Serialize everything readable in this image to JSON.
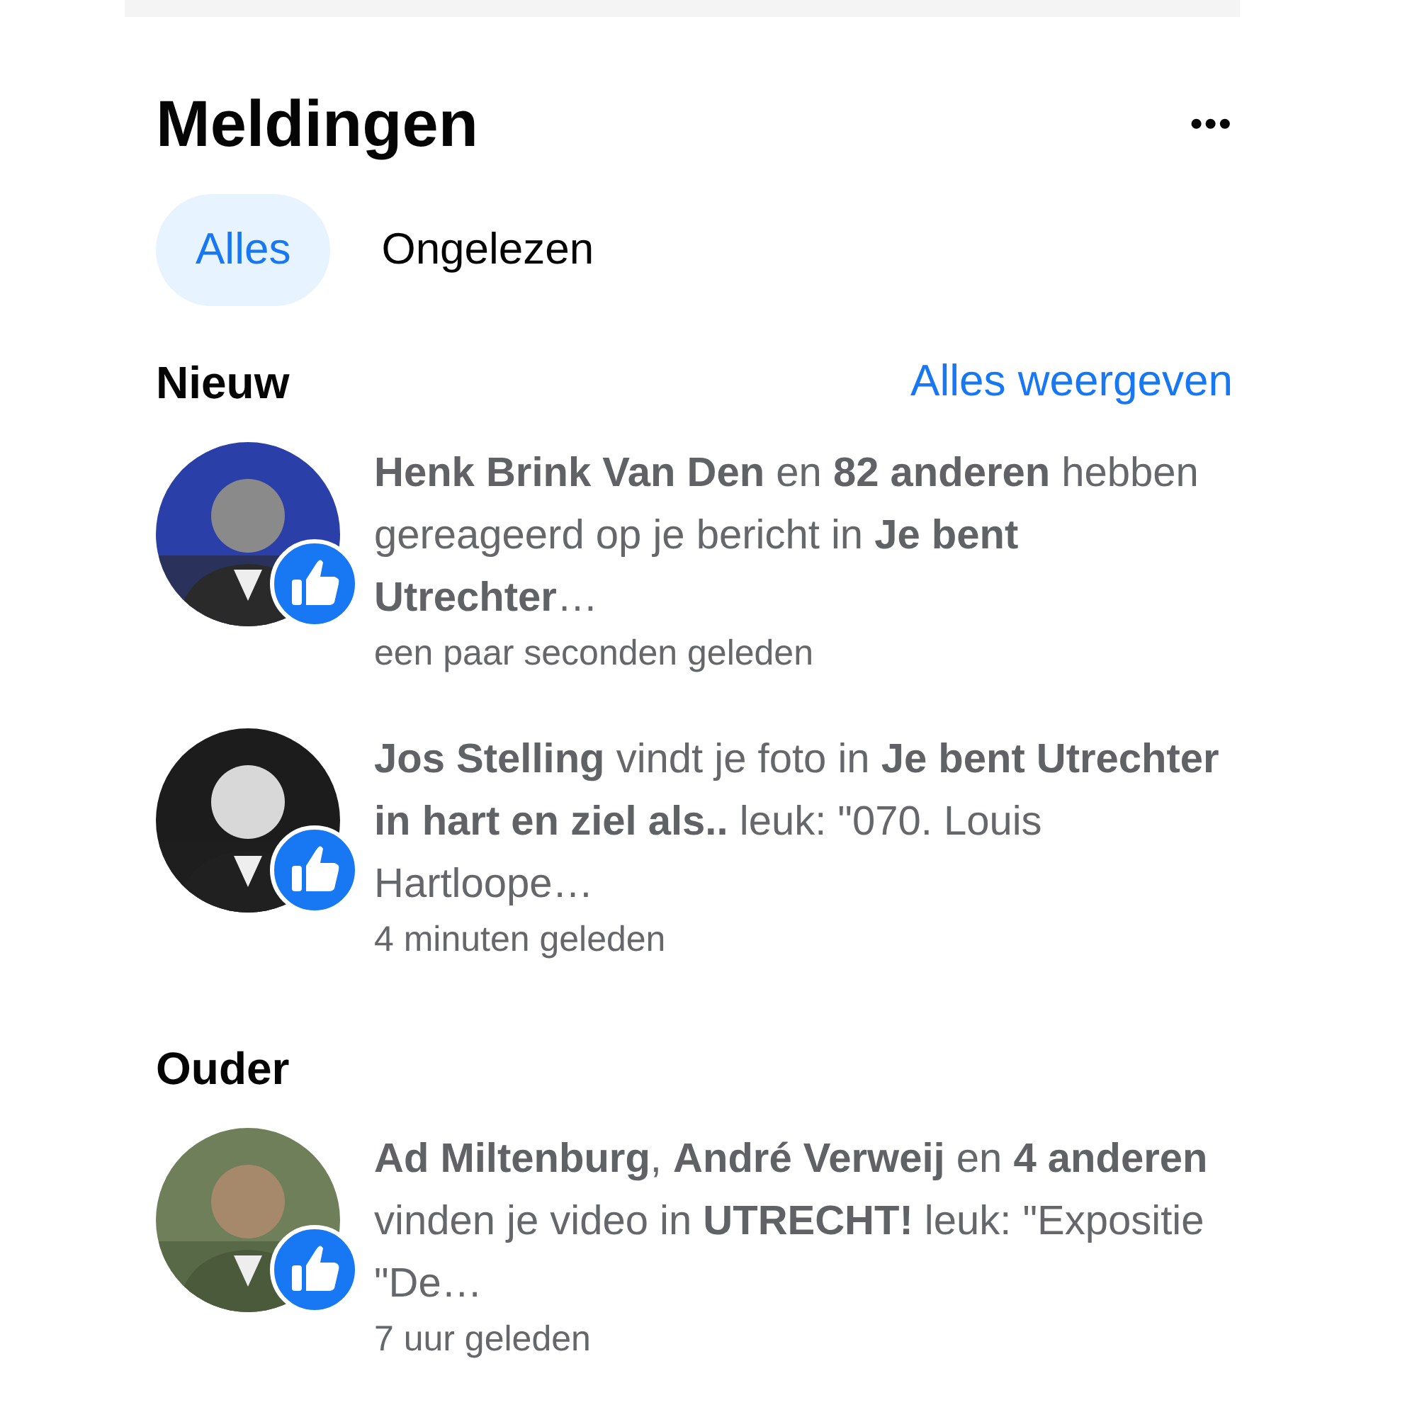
{
  "header": {
    "title": "Meldingen",
    "menu": "•••"
  },
  "tabs": [
    {
      "label": "Alles",
      "selected": true
    },
    {
      "label": "Ongelezen",
      "selected": false
    }
  ],
  "sections": [
    {
      "title": "Nieuw",
      "link": "Alles weergeven",
      "items": [
        {
          "kind": "picture",
          "text": "**Henk Brink Van Den** en **82 anderen** hebben gereageerd op je bericht in **Je bent Utrechter**…",
          "time": "een paar seconden geleden"
        },
        {
          "kind": "picture",
          "text": "**Jos Stelling** vindt je foto in **Je bent Utrechter in hart en ziel als..** leuk: \"070. Louis Hartloope…",
          "time": "4 minuten geleden"
        }
      ]
    },
    {
      "title": "Ouder",
      "items": [
        {
          "kind": "picture",
          "text": "**Ad Miltenburg**, **André Verweij** en **4 anderen** vinden je video in **UTRECHT!** leuk: \"Expositie \"De…",
          "time": "7 uur geleden"
        }
      ]
    }
  ]
}
